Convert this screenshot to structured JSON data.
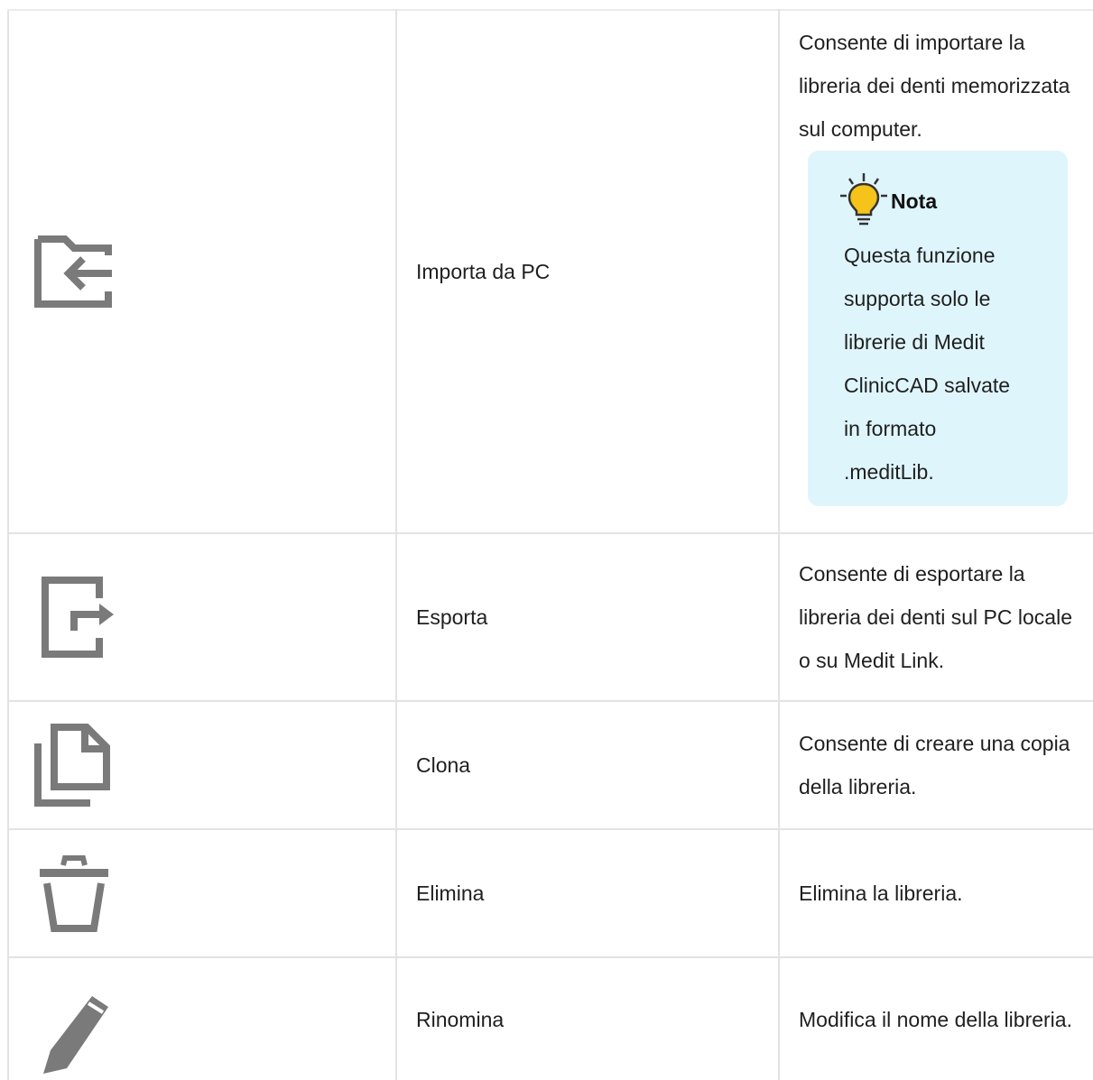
{
  "rows": [
    {
      "icon": "import-folder-icon",
      "name": "Importa da PC",
      "description": "Consente di importare la libreria dei denti memorizzata sul computer.",
      "note": {
        "icon": "lightbulb-icon",
        "title": "Nota",
        "text": "Questa funzione supporta solo le librerie di Medit ClinicCAD salvate in formato .meditLib."
      }
    },
    {
      "icon": "export-icon",
      "name": "Esporta",
      "description": "Consente di esportare la libreria dei denti sul PC locale o su Medit Link."
    },
    {
      "icon": "clone-icon",
      "name": "Clona",
      "description": "Consente di creare una copia della libreria."
    },
    {
      "icon": "trash-icon",
      "name": "Elimina",
      "description": "Elimina la libreria."
    },
    {
      "icon": "pencil-icon",
      "name": "Rinomina",
      "description": "Modifica il nome della libreria."
    }
  ],
  "colors": {
    "icon": "#7a7a7a",
    "border": "#e3e3e3",
    "note_background": "#dff5fc",
    "bulb": "#f6c31a"
  }
}
